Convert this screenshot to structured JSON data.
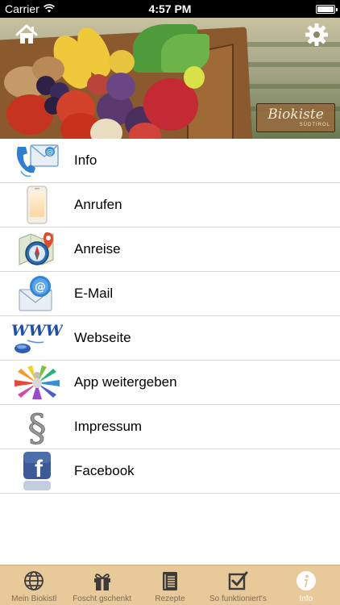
{
  "status_bar": {
    "carrier": "Carrier",
    "time": "4:57 PM",
    "battery_level": 1.0
  },
  "header": {
    "home_icon": "home-icon",
    "settings_icon": "gear-icon",
    "logo": {
      "name": "Biokiste",
      "subtitle": "SÜDTIROL"
    }
  },
  "menu": {
    "items": [
      {
        "label": "Info",
        "icon": "phone-mail-icon"
      },
      {
        "label": "Anrufen",
        "icon": "smartphone-icon"
      },
      {
        "label": "Anreise",
        "icon": "compass-map-icon"
      },
      {
        "label": "E-Mail",
        "icon": "email-icon"
      },
      {
        "label": "Webseite",
        "icon": "www-mouse-icon"
      },
      {
        "label": "App weitergeben",
        "icon": "share-people-icon"
      },
      {
        "label": "Impressum",
        "icon": "paragraph-icon"
      },
      {
        "label": "Facebook",
        "icon": "facebook-icon"
      }
    ]
  },
  "tab_bar": {
    "active_index": 4,
    "colors": {
      "background": "#e8c99a",
      "inactive": "#7d6a55",
      "active": "#ffffff"
    },
    "tabs": [
      {
        "label": "Mein Biokistl",
        "icon": "globe-icon"
      },
      {
        "label": "Foscht gschenkt",
        "icon": "gift-icon"
      },
      {
        "label": "Rezepte",
        "icon": "recipe-book-icon"
      },
      {
        "label": "So funktioniert's",
        "icon": "checkbox-icon"
      },
      {
        "label": "Info",
        "icon": "info-icon"
      }
    ]
  }
}
